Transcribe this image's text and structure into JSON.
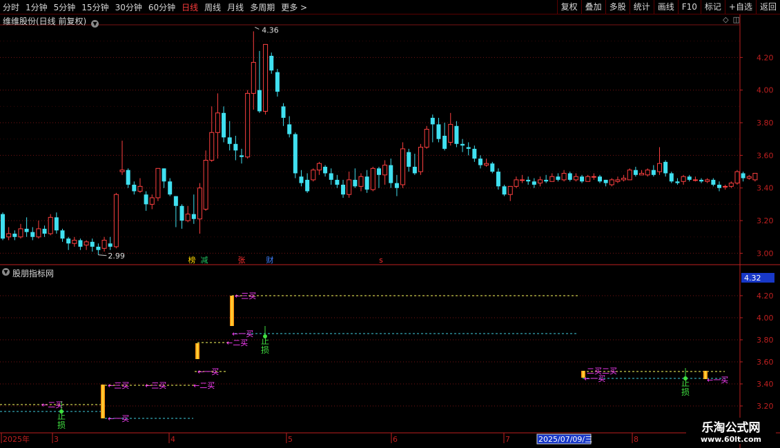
{
  "toolbar": {
    "periods": [
      "分时",
      "1分钟",
      "5分钟",
      "15分钟",
      "30分钟",
      "60分钟",
      "日线",
      "周线",
      "月线",
      "多周期",
      "更多 >"
    ],
    "active_period": "日线",
    "right_buttons": [
      "复权",
      "叠加",
      "多股",
      "统计",
      "画线",
      "F10",
      "标记",
      "+自选",
      "返回"
    ]
  },
  "chart_title": "维维股份(日线 前复权)",
  "indicator_title": "股朋指标网",
  "price_axis_labels": [
    "4.20",
    "4.00",
    "3.80",
    "3.60",
    "3.40",
    "3.20",
    "3.00"
  ],
  "indicator_axis_labels": [
    "4.20",
    "4.00",
    "3.80",
    "3.60",
    "3.40",
    "3.20"
  ],
  "indicator_current_value": "4.32",
  "high_label": "4.36",
  "low_label": "2.99",
  "event_markers": [
    {
      "text": "榜",
      "color": "#ffd700"
    },
    {
      "text": "减",
      "color": "#20c060"
    },
    {
      "text": "张",
      "color": "#ff3030"
    },
    {
      "text": "财",
      "color": "#4080ff"
    },
    {
      "text": "s",
      "color": "#ff3030"
    }
  ],
  "date_axis": {
    "labels": [
      "2025年",
      "3",
      "4",
      "5",
      "6",
      "7",
      "8"
    ],
    "cursor_date": "2025/07/09/三"
  },
  "signals": {
    "buy1": "一买",
    "buy2": "二买",
    "buy3": "三买",
    "stop_loss_1": "止",
    "stop_loss_2": "损",
    "combo_label": "二买二买"
  },
  "colors": {
    "up": "#ff4040",
    "down": "#40e0f0",
    "grid": "#7a1414",
    "axis": "#c02020",
    "signal_text": "#ff40ff",
    "stop_text": "#40e040",
    "yellow_line": "#ffff60",
    "cyan_line": "#40d0e0"
  },
  "watermark": {
    "line1": "乐淘公式网",
    "line2": "www.60lt.com"
  },
  "chart_data": {
    "type": "candlestick",
    "candles": [
      [
        3.24,
        3.09,
        3.25,
        3.08
      ],
      [
        3.1,
        3.12,
        3.16,
        3.08
      ],
      [
        3.12,
        3.1,
        3.14,
        3.08
      ],
      [
        3.1,
        3.15,
        3.18,
        3.09
      ],
      [
        3.15,
        3.13,
        3.22,
        3.1
      ],
      [
        3.13,
        3.1,
        3.16,
        3.08
      ],
      [
        3.1,
        3.15,
        3.2,
        3.09
      ],
      [
        3.15,
        3.12,
        3.17,
        3.1
      ],
      [
        3.12,
        3.22,
        3.24,
        3.11
      ],
      [
        3.22,
        3.14,
        3.25,
        3.12
      ],
      [
        3.14,
        3.09,
        3.15,
        3.07
      ],
      [
        3.09,
        3.06,
        3.1,
        3.02
      ],
      [
        3.06,
        3.08,
        3.1,
        3.04
      ],
      [
        3.08,
        3.04,
        3.09,
        3.02
      ],
      [
        3.05,
        3.07,
        3.08,
        3.02
      ],
      [
        3.07,
        3.04,
        3.09,
        3.01
      ],
      [
        3.04,
        3.02,
        3.06,
        2.99
      ],
      [
        3.03,
        3.08,
        3.1,
        3.01
      ],
      [
        3.06,
        3.04,
        3.1,
        3.02
      ],
      [
        3.04,
        3.36,
        3.37,
        3.03
      ],
      [
        3.5,
        3.51,
        3.69,
        3.48
      ],
      [
        3.51,
        3.42,
        3.52,
        3.4
      ],
      [
        3.42,
        3.38,
        3.44,
        3.36
      ],
      [
        3.38,
        3.41,
        3.46,
        3.37
      ],
      [
        3.36,
        3.3,
        3.38,
        3.26
      ],
      [
        3.3,
        3.34,
        3.36,
        3.27
      ],
      [
        3.34,
        3.52,
        3.52,
        3.32
      ],
      [
        3.52,
        3.44,
        3.52,
        3.4
      ],
      [
        3.44,
        3.36,
        3.46,
        3.35
      ],
      [
        3.35,
        3.29,
        3.35,
        3.16
      ],
      [
        3.29,
        3.2,
        3.3,
        3.15
      ],
      [
        3.2,
        3.24,
        3.29,
        3.19
      ],
      [
        3.24,
        3.21,
        3.36,
        3.18
      ],
      [
        3.21,
        3.4,
        3.43,
        3.12
      ],
      [
        3.27,
        3.57,
        3.63,
        3.26
      ],
      [
        3.57,
        3.74,
        3.9,
        3.56
      ],
      [
        3.74,
        3.86,
        3.98,
        3.58
      ],
      [
        3.86,
        3.71,
        3.9,
        3.68
      ],
      [
        3.71,
        3.67,
        3.81,
        3.63
      ],
      [
        3.67,
        3.63,
        3.72,
        3.57
      ],
      [
        3.6,
        3.59,
        3.64,
        3.55
      ],
      [
        3.59,
        3.98,
        4.0,
        3.58
      ],
      [
        3.98,
        4.17,
        4.36,
        3.88
      ],
      [
        4.0,
        3.87,
        4.24,
        3.86
      ],
      [
        3.87,
        4.28,
        4.28,
        3.85
      ],
      [
        4.21,
        4.12,
        4.23,
        4.1
      ],
      [
        4.11,
        3.99,
        4.13,
        3.96
      ],
      [
        3.9,
        3.83,
        3.92,
        3.78
      ],
      [
        3.79,
        3.73,
        3.84,
        3.71
      ],
      [
        3.73,
        3.49,
        3.74,
        3.46
      ],
      [
        3.47,
        3.43,
        3.51,
        3.41
      ],
      [
        3.45,
        3.38,
        3.49,
        3.37
      ],
      [
        3.45,
        3.51,
        3.52,
        3.44
      ],
      [
        3.51,
        3.55,
        3.56,
        3.48
      ],
      [
        3.53,
        3.49,
        3.54,
        3.47
      ],
      [
        3.49,
        3.45,
        3.52,
        3.42
      ],
      [
        3.45,
        3.42,
        3.48,
        3.4
      ],
      [
        3.42,
        3.36,
        3.45,
        3.34
      ],
      [
        3.36,
        3.45,
        3.5,
        3.34
      ],
      [
        3.45,
        3.41,
        3.52,
        3.4
      ],
      [
        3.41,
        3.47,
        3.49,
        3.38
      ],
      [
        3.47,
        3.39,
        3.51,
        3.37
      ],
      [
        3.39,
        3.52,
        3.53,
        3.38
      ],
      [
        3.52,
        3.48,
        3.53,
        3.4
      ],
      [
        3.48,
        3.54,
        3.57,
        3.42
      ],
      [
        3.54,
        3.43,
        3.58,
        3.4
      ],
      [
        3.43,
        3.4,
        3.48,
        3.35
      ],
      [
        3.42,
        3.64,
        3.68,
        3.4
      ],
      [
        3.62,
        3.53,
        3.64,
        3.5
      ],
      [
        3.53,
        3.49,
        3.61,
        3.48
      ],
      [
        3.5,
        3.65,
        3.67,
        3.48
      ],
      [
        3.65,
        3.76,
        3.78,
        3.64
      ],
      [
        3.83,
        3.79,
        3.85,
        3.68
      ],
      [
        3.79,
        3.7,
        3.83,
        3.68
      ],
      [
        3.72,
        3.64,
        3.8,
        3.63
      ],
      [
        3.68,
        3.79,
        3.86,
        3.66
      ],
      [
        3.78,
        3.67,
        3.81,
        3.65
      ],
      [
        3.67,
        3.66,
        3.7,
        3.62
      ],
      [
        3.65,
        3.64,
        3.68,
        3.6
      ],
      [
        3.64,
        3.58,
        3.66,
        3.56
      ],
      [
        3.58,
        3.54,
        3.6,
        3.52
      ],
      [
        3.54,
        3.55,
        3.58,
        3.53
      ],
      [
        3.55,
        3.5,
        3.56,
        3.49
      ],
      [
        3.5,
        3.41,
        3.52,
        3.39
      ],
      [
        3.41,
        3.36,
        3.42,
        3.35
      ],
      [
        3.36,
        3.41,
        3.41,
        3.32
      ],
      [
        3.41,
        3.45,
        3.47,
        3.4
      ],
      [
        3.45,
        3.45,
        3.48,
        3.43
      ],
      [
        3.45,
        3.44,
        3.47,
        3.42
      ],
      [
        3.44,
        3.42,
        3.46,
        3.4
      ],
      [
        3.43,
        3.45,
        3.47,
        3.41
      ],
      [
        3.45,
        3.44,
        3.48,
        3.43
      ],
      [
        3.44,
        3.47,
        3.49,
        3.44
      ],
      [
        3.47,
        3.45,
        3.49,
        3.44
      ],
      [
        3.45,
        3.49,
        3.51,
        3.44
      ],
      [
        3.49,
        3.45,
        3.5,
        3.44
      ],
      [
        3.45,
        3.47,
        3.49,
        3.44
      ],
      [
        3.47,
        3.44,
        3.48,
        3.43
      ],
      [
        3.44,
        3.47,
        3.48,
        3.44
      ],
      [
        3.47,
        3.47,
        3.49,
        3.45
      ],
      [
        3.47,
        3.44,
        3.48,
        3.43
      ],
      [
        3.45,
        3.43,
        3.45,
        3.41
      ],
      [
        3.42,
        3.45,
        3.46,
        3.41
      ],
      [
        3.44,
        3.45,
        3.47,
        3.43
      ],
      [
        3.45,
        3.46,
        3.48,
        3.44
      ],
      [
        3.45,
        3.51,
        3.52,
        3.45
      ],
      [
        3.51,
        3.48,
        3.53,
        3.47
      ],
      [
        3.48,
        3.49,
        3.51,
        3.48
      ],
      [
        3.48,
        3.51,
        3.52,
        3.47
      ],
      [
        3.51,
        3.48,
        3.54,
        3.47
      ],
      [
        3.5,
        3.55,
        3.65,
        3.48
      ],
      [
        3.56,
        3.49,
        3.57,
        3.47
      ],
      [
        3.49,
        3.44,
        3.5,
        3.43
      ],
      [
        3.44,
        3.43,
        3.46,
        3.42
      ],
      [
        3.44,
        3.47,
        3.48,
        3.42
      ],
      [
        3.47,
        3.45,
        3.48,
        3.44
      ],
      [
        3.45,
        3.45,
        3.47,
        3.44
      ],
      [
        3.45,
        3.44,
        3.46,
        3.43
      ],
      [
        3.44,
        3.45,
        3.46,
        3.43
      ],
      [
        3.45,
        3.42,
        3.46,
        3.41
      ],
      [
        3.42,
        3.4,
        3.44,
        3.38
      ],
      [
        3.41,
        3.41,
        3.42,
        3.39
      ],
      [
        3.41,
        3.43,
        3.44,
        3.4
      ],
      [
        3.43,
        3.5,
        3.51,
        3.42
      ],
      [
        3.49,
        3.46,
        3.5,
        3.44
      ],
      [
        3.46,
        3.47,
        3.48,
        3.45
      ],
      [
        3.45,
        3.49,
        3.49,
        3.44
      ]
    ],
    "ylim": [
      2.93,
      4.4
    ]
  }
}
